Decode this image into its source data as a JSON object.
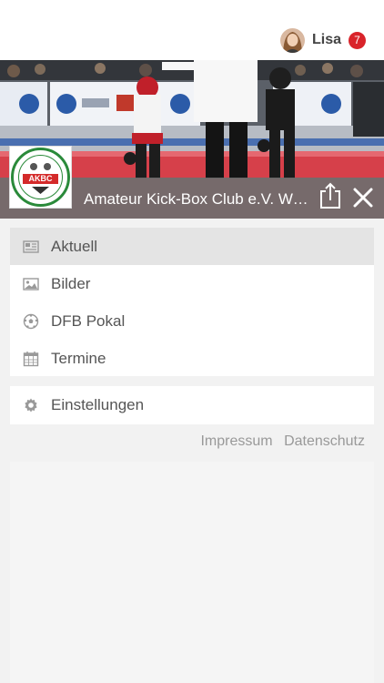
{
  "user": {
    "name": "Lisa",
    "notifications": "7"
  },
  "club": {
    "name": "Amateur Kick-Box Club e.V. Wolfsburg",
    "logo_text": "AKBC"
  },
  "menu": {
    "items": [
      {
        "label": "Aktuell",
        "icon": "newspaper-icon",
        "active": true
      },
      {
        "label": "Bilder",
        "icon": "image-icon"
      },
      {
        "label": "DFB Pokal",
        "icon": "soccer-ball-icon"
      },
      {
        "label": "Termine",
        "icon": "calendar-icon"
      }
    ],
    "settings_label": "Einstellungen"
  },
  "footer": {
    "impressum": "Impressum",
    "datenschutz": "Datenschutz"
  },
  "colors": {
    "badge": "#d9232a",
    "club_bar": "#6e6e6e",
    "active_item": "#e4e4e4"
  }
}
